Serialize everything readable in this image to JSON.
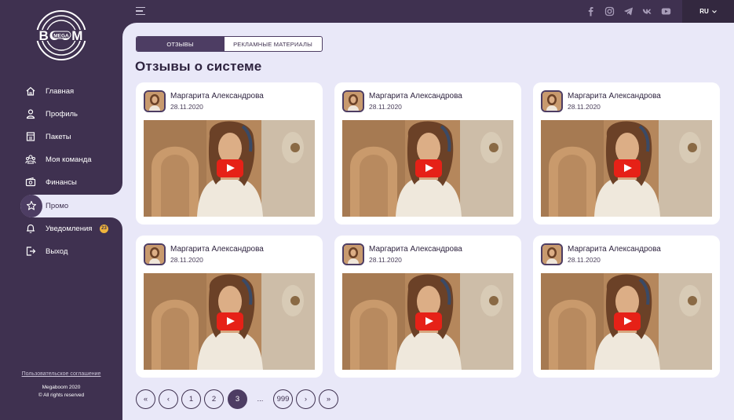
{
  "brand": {
    "logo_top": "BOOM",
    "logo_mid": "MEGA"
  },
  "nav": {
    "items": [
      {
        "label": "Главная",
        "icon": "home-icon"
      },
      {
        "label": "Профиль",
        "icon": "user-icon"
      },
      {
        "label": "Пакеты",
        "icon": "package-icon"
      },
      {
        "label": "Моя команда",
        "icon": "team-icon"
      },
      {
        "label": "Финансы",
        "icon": "wallet-icon"
      },
      {
        "label": "Промо",
        "icon": "star-icon"
      },
      {
        "label": "Уведомления",
        "icon": "bell-icon"
      },
      {
        "label": "Выход",
        "icon": "logout-icon"
      }
    ],
    "active": "Промо",
    "notifications_count": "23"
  },
  "footer": {
    "agreement": "Пользовательское соглашение",
    "copyright_line1": "Megaboom 2020",
    "copyright_line2": "© All rights reserved"
  },
  "topbar": {
    "social": [
      "facebook-icon",
      "instagram-icon",
      "telegram-icon",
      "vk-icon",
      "youtube-icon"
    ],
    "language": "RU"
  },
  "tabs": [
    {
      "label": "Отзывы",
      "active": true
    },
    {
      "label": "Рекламные материалы",
      "active": false
    }
  ],
  "page_title": "Отзывы о системе",
  "reviews": [
    {
      "author": "Маргарита Александрова",
      "date": "28.11.2020"
    },
    {
      "author": "Маргарита Александрова",
      "date": "28.11.2020"
    },
    {
      "author": "Маргарита Александрова",
      "date": "28.11.2020"
    },
    {
      "author": "Маргарита Александрова",
      "date": "28.11.2020"
    },
    {
      "author": "Маргарита Александрова",
      "date": "28.11.2020"
    },
    {
      "author": "Маргарита Александрова",
      "date": "28.11.2020"
    }
  ],
  "pagination": {
    "first": "«",
    "prev": "‹",
    "pages": [
      "1",
      "2",
      "3"
    ],
    "current": "3",
    "ellipsis": "...",
    "last_page": "999",
    "next": "›",
    "last": "»"
  },
  "colors": {
    "sidebar": "#3f3150",
    "accent": "#4d3d63",
    "background": "#e9e8f8",
    "badge": "#f0b43c",
    "play": "#e62117"
  }
}
